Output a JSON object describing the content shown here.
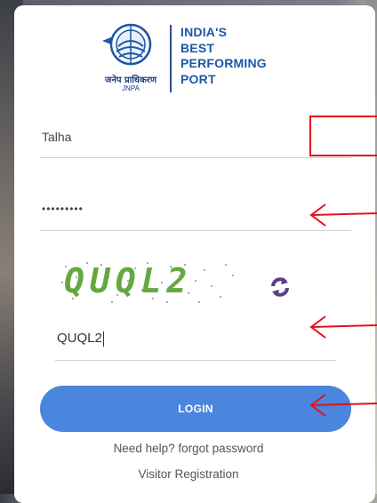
{
  "logo": {
    "hindi_text": "जनेप प्राधिकरण",
    "abbr": "JNPA",
    "tagline_lines": [
      "INDIA'S",
      "BEST",
      "PERFORMING",
      "PORT"
    ]
  },
  "form": {
    "username_value": "Talha",
    "password_value": "•••••••••",
    "captcha_image_text": "QUQL2",
    "captcha_input_value": "QUQL2",
    "login_label": "LOGIN",
    "help_link": "Need help? forgot password",
    "visitor_link": "Visitor Registration"
  },
  "colors": {
    "brand_blue": "#1b57a8",
    "button_blue": "#4a86dd",
    "captcha_green": "#65a840",
    "refresh_purple": "#5a3d8a",
    "annotation_red": "#e3101a"
  },
  "icons": {
    "refresh": "refresh-icon",
    "logo": "jnpa-emblem-icon"
  }
}
